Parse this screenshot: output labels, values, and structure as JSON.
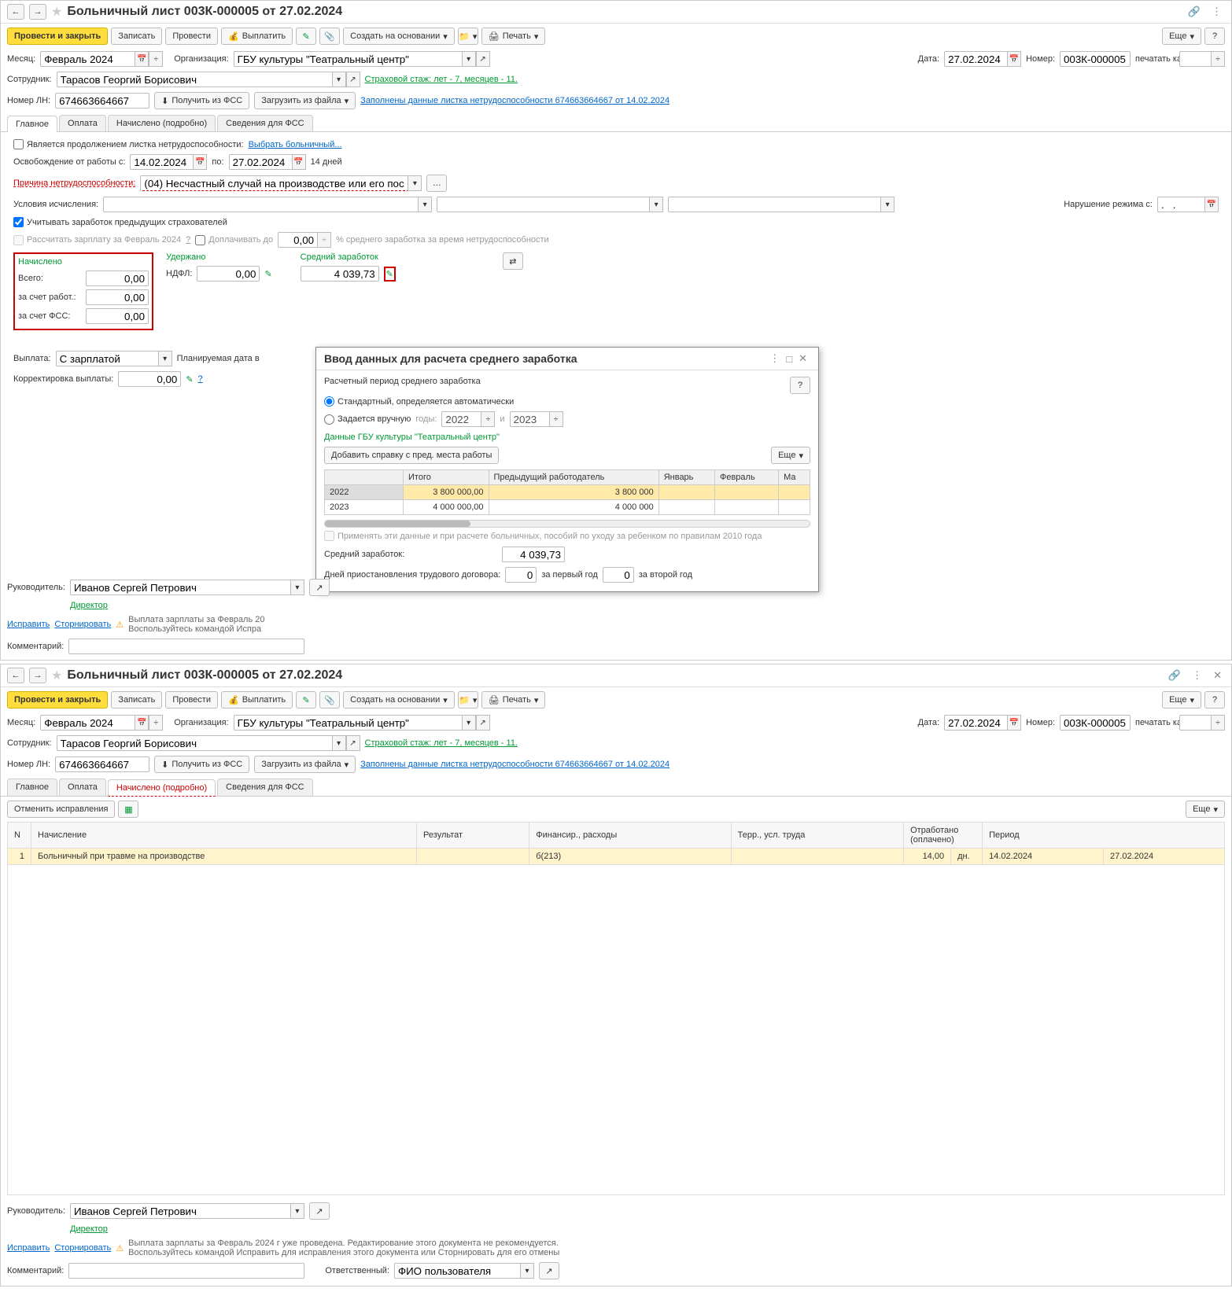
{
  "win1": {
    "title": "Больничный лист 003К-000005 от 27.02.2024",
    "toolbar": {
      "post_close": "Провести и закрыть",
      "save": "Записать",
      "post": "Провести",
      "pay": "Выплатить",
      "create_based": "Создать на основании",
      "print": "Печать",
      "more": "Еще",
      "help": "?"
    },
    "header": {
      "month_lbl": "Месяц:",
      "month_val": "Февраль 2024",
      "org_lbl": "Организация:",
      "org_val": "ГБУ культуры \"Театральный центр\"",
      "date_lbl": "Дата:",
      "date_val": "27.02.2024",
      "number_lbl": "Номер:",
      "number_val": "003К-000005",
      "print_as_lbl": "печатать как:",
      "employee_lbl": "Сотрудник:",
      "employee_val": "Тарасов Георгий Борисович",
      "insurance_link": "Страховой стаж: лет - 7, месяцев - 11.",
      "ln_lbl": "Номер ЛН:",
      "ln_val": "674663664667",
      "get_fss": "Получить из ФСС",
      "load_file": "Загрузить из файла",
      "filled_link": "Заполнены данные листка нетрудоспособности 674663664667 от 14.02.2024"
    },
    "tabs": {
      "main": "Главное",
      "payment": "Оплата",
      "accrued": "Начислено (подробно)",
      "fss": "Сведения для ФСС"
    },
    "main_tab": {
      "continuation_lbl": "Является продолжением листка нетрудоспособности:",
      "select_sick": "Выбрать больничный...",
      "release_lbl": "Освобождение от работы с:",
      "release_from": "14.02.2024",
      "release_to_lbl": "по:",
      "release_to": "27.02.2024",
      "days": "14 дней",
      "reason_lbl": "Причина нетрудоспособности:",
      "reason_val": "(04) Несчастный случай на производстве или его последствия",
      "calc_cond_lbl": "Условия исчисления:",
      "violation_lbl": "Нарушение режима с:",
      "violation_val": ".   .",
      "prev_insurers": "Учитывать заработок предыдущих страхователей",
      "calc_salary": "Рассчитать зарплату за Февраль 2024",
      "extra_pay_lbl": "Доплачивать до",
      "extra_pay_val": "0,00",
      "extra_pay_pct": "% среднего заработка за время нетрудоспособности",
      "accrued_hdr": "Начислено",
      "total_lbl": "Всего:",
      "total_val": "0,00",
      "employer_lbl": "за счет работ.:",
      "employer_val": "0,00",
      "fss_share_lbl": "за счет ФСС:",
      "fss_share_val": "0,00",
      "withheld_hdr": "Удержано",
      "ndfl_lbl": "НДФЛ:",
      "ndfl_val": "0,00",
      "avg_hdr": "Средний заработок",
      "avg_val": "4 039,73",
      "payment_lbl": "Выплата:",
      "payment_val": "С зарплатой",
      "planned_lbl": "Планируемая дата в",
      "correction_lbl": "Корректировка выплаты:",
      "correction_val": "0,00"
    },
    "dialog": {
      "title": "Ввод данных для расчета среднего заработка",
      "period_lbl": "Расчетный период среднего заработка",
      "std_radio": "Стандартный, определяется автоматически",
      "manual_radio": "Задается вручную",
      "years_lbl": "годы:",
      "year1": "2022",
      "and_lbl": "и",
      "year2": "2023",
      "data_hdr": "Данные ГБУ культуры \"Театральный центр\"",
      "add_ref": "Добавить справку с пред. места работы",
      "more": "Еще",
      "col_total": "Итого",
      "col_prev": "Предыдущий работодатель",
      "col_jan": "Январь",
      "col_feb": "Февраль",
      "col_ma": "Ма",
      "row1_year": "2022",
      "row1_total": "3 800 000,00",
      "row1_prev": "3 800 000",
      "row2_year": "2023",
      "row2_total": "4 000 000,00",
      "row2_prev": "4 000 000",
      "apply_lbl": "Применять эти данные и при расчете больничных, пособий по уходу за ребенком по правилам 2010 года",
      "avg_lbl": "Средний заработок:",
      "avg_val": "4 039,73",
      "susp_lbl": "Дней приостановления трудового договора:",
      "susp_y1_val": "0",
      "susp_y1_lbl": "за первый год",
      "susp_y2_val": "0",
      "susp_y2_lbl": "за второй год"
    },
    "footer": {
      "manager_lbl": "Руководитель:",
      "manager_val": "Иванов Сергей Петрович",
      "director": "Директор",
      "fix_link": "Исправить",
      "storno_link": "Сторнировать",
      "warn_line1": "Выплата зарплаты за Февраль 20",
      "warn_line2": "Воспользуйтесь командой Испра",
      "comment_lbl": "Комментарий:"
    }
  },
  "win2": {
    "toolbar2": {
      "cancel_fix": "Отменить исправления",
      "more": "Еще"
    },
    "table": {
      "col_n": "N",
      "col_accrual": "Начисление",
      "col_result": "Результат",
      "col_fin": "Финансир., расходы",
      "col_terr": "Терр., усл. труда",
      "col_worked": "Отработано (оплачено)",
      "col_period": "Период",
      "r1_n": "1",
      "r1_accrual": "Больничный при травме на производстве",
      "r1_fin": "б(213)",
      "r1_worked": "14,00",
      "r1_unit": "дн.",
      "r1_period_from": "14.02.2024",
      "r1_period_to": "27.02.2024"
    },
    "footer2": {
      "warn_line1": "Выплата зарплаты за Февраль 2024 г уже проведена. Редактирование этого документа не рекомендуется.",
      "warn_line2": "Воспользуйтесь командой Исправить для исправления этого документа или Сторнировать для его отмены",
      "resp_lbl": "Ответственный:",
      "resp_val": "ФИО пользователя"
    }
  }
}
